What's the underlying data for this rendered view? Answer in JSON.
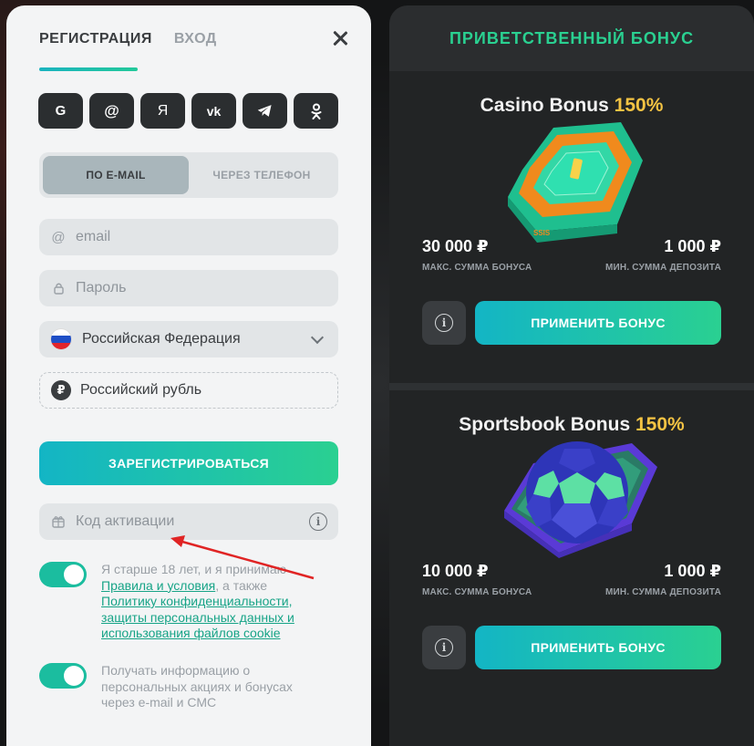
{
  "auth_tabs": {
    "register": "РЕГИСТРАЦИЯ",
    "login": "ВХОД"
  },
  "social": [
    "G",
    "@",
    "Я",
    "vk",
    "telegram",
    "ok"
  ],
  "method_switch": {
    "email": "ПО E-MAIL",
    "phone": "ЧЕРЕЗ ТЕЛЕФОН"
  },
  "form": {
    "email_placeholder": "email",
    "password_placeholder": "Пароль",
    "country": "Российская Федерация",
    "currency": "Российский рубль",
    "currency_symbol": "₽",
    "register_label": "ЗАРЕГИСТРИРОВАТЬСЯ",
    "promo_placeholder": "Код активации"
  },
  "consent": {
    "text_before": "Я старше 18 лет, и я принимаю ",
    "rules_link": "Правила и условия",
    "text_middle": ", а также ",
    "privacy_link": "Политику конфиденциальности, защиты персональных данных и использования файлов cookie"
  },
  "newsletter": {
    "text": "Получать информацию о персональных акциях и бонусах через e-mail и СМС"
  },
  "welcome": {
    "title": "ПРИВЕТСТВЕННЫЙ БОНУС",
    "cards": [
      {
        "name": "Casino Bonus",
        "percent": "150%",
        "max_amount": "30 000 ₽",
        "max_label": "МАКС. СУММА БОНУСА",
        "min_amount": "1 000 ₽",
        "min_label": "МИН. СУММА ДЕПОЗИТА",
        "apply_label": "ПРИМЕНИТЬ БОНУС"
      },
      {
        "name": "Sportsbook Bonus",
        "percent": "150%",
        "max_amount": "10 000 ₽",
        "max_label": "МАКС. СУММА БОНУСА",
        "min_amount": "1 000 ₽",
        "min_label": "МИН. СУММА ДЕПОЗИТА",
        "apply_label": "ПРИМЕНИТЬ БОНУС"
      }
    ]
  },
  "colors": {
    "accent_start": "#13b5c5",
    "accent_end": "#2ad091",
    "bonus_yellow": "#f4c343"
  }
}
